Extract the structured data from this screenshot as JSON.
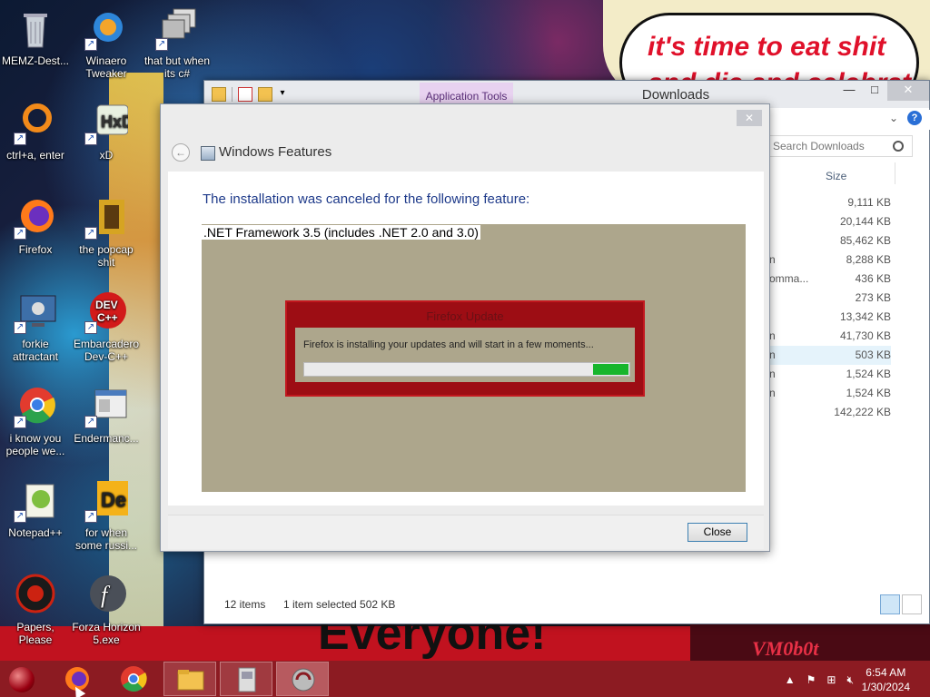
{
  "desktop": {
    "icons": [
      {
        "label": "MEMZ-Dest...",
        "icon": "recycle-bin-icon"
      },
      {
        "label": "Winaero Tweaker",
        "icon": "winaero-icon"
      },
      {
        "label": "that but when its c#",
        "icon": "windows-stack-icon"
      },
      {
        "label": "ctrl+a, enter",
        "icon": "orange-ring-icon"
      },
      {
        "label": "xD",
        "icon": "hxd-icon"
      },
      {
        "label": "Firefox",
        "icon": "firefox-icon"
      },
      {
        "label": "the popcap shit",
        "icon": "popcap-icon"
      },
      {
        "label": "forkie attractant",
        "icon": "settings-monitor-icon"
      },
      {
        "label": "Embarcadero Dev-C++",
        "icon": "devcpp-icon"
      },
      {
        "label": "i know you people we...",
        "icon": "chrome-icon"
      },
      {
        "label": "Endermanc...",
        "icon": "window-app-icon"
      },
      {
        "label": "Notepad++",
        "icon": "notepadpp-icon"
      },
      {
        "label": "for when some russi...",
        "icon": "de-icon"
      },
      {
        "label": "Papers, Please",
        "icon": "papers-please-icon"
      },
      {
        "label": "Forza Horizon 5.exe",
        "icon": "flash-icon"
      }
    ]
  },
  "wallpaper": {
    "bubble_line1": "it's time to eat shit",
    "bubble_line2": "and die and celebrate",
    "bottom_text": "Everyone!",
    "bottom_right_text": "VM0b0t"
  },
  "explorer": {
    "app_tools_tab": "Application Tools",
    "title": "Downloads",
    "search_placeholder": "Search Downloads",
    "column_size": "Size",
    "rows": [
      {
        "stub": "",
        "size": "9,111 KB"
      },
      {
        "stub": "",
        "size": "20,144 KB"
      },
      {
        "stub": "",
        "size": "85,462 KB"
      },
      {
        "stub": "n",
        "size": "8,288 KB"
      },
      {
        "stub": "omma...",
        "size": "436 KB"
      },
      {
        "stub": "",
        "size": "273 KB"
      },
      {
        "stub": "",
        "size": "13,342 KB"
      },
      {
        "stub": "n",
        "size": "41,730 KB"
      },
      {
        "stub": "n",
        "size": "503 KB"
      },
      {
        "stub": "n",
        "size": "1,524 KB"
      },
      {
        "stub": "n",
        "size": "1,524 KB"
      },
      {
        "stub": "",
        "size": "142,222 KB"
      }
    ],
    "status_items": "12 items",
    "status_selected": "1 item selected  502 KB"
  },
  "features_dialog": {
    "title": "Windows Features",
    "heading": "The installation was canceled for the following feature:",
    "feature": ".NET Framework 3.5 (includes .NET 2.0 and 3.0)",
    "close_button": "Close"
  },
  "firefox_update": {
    "title": "Firefox Update",
    "message": "Firefox is installing your updates and will start in a few moments...",
    "progress_fraction": 0.11
  },
  "taskbar": {
    "clock_time": "6:54 AM",
    "clock_date": "1/30/2024"
  },
  "colors": {
    "taskbar": "#8c1b22",
    "firefox_frame": "#9d0d14",
    "progress_green": "#17b52c",
    "app_tools_bg": "#e8d2f0"
  }
}
